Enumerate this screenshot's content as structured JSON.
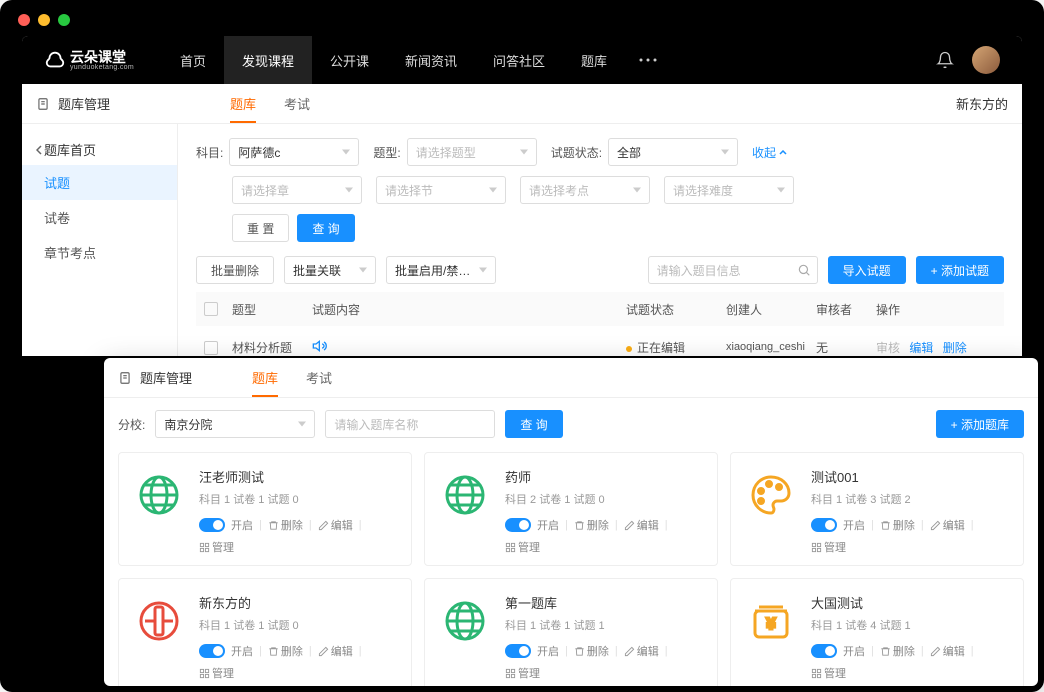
{
  "logo": {
    "name": "云朵课堂",
    "sub": "yunduoketang.com"
  },
  "nav": [
    "首页",
    "发现课程",
    "公开课",
    "新闻资讯",
    "问答社区",
    "题库"
  ],
  "nav_active": "发现课程",
  "win1": {
    "title": "题库管理",
    "tabs": [
      "题库",
      "考试"
    ],
    "org": "新东方的",
    "crumb": "题库首页",
    "sidebar": [
      "试题",
      "试卷",
      "章节考点"
    ],
    "filter_labels": {
      "subject": "科目:",
      "type": "题型:",
      "status": "试题状态:"
    },
    "subject_value": "阿萨德c",
    "type_placeholder": "请选择题型",
    "status_value": "全部",
    "chapter_placeholder": "请选择章",
    "section_placeholder": "请选择节",
    "point_placeholder": "请选择考点",
    "difficulty_placeholder": "请选择难度",
    "collapse_label": "收起",
    "reset_btn": "重 置",
    "search_btn": "查 询",
    "batch_delete": "批量删除",
    "batch_relate": "批量关联",
    "batch_toggle": "批量启用/禁…",
    "search_placeholder": "请输入题目信息",
    "import_btn": "导入试题",
    "add_btn": "+ 添加试题",
    "cols": {
      "type": "题型",
      "content": "试题内容",
      "status": "试题状态",
      "creator": "创建人",
      "reviewer": "审核者",
      "ops": "操作"
    },
    "row": {
      "type": "材料分析题",
      "status": "正在编辑",
      "creator": "xiaoqiang_ceshi",
      "reviewer": "无",
      "ops_review": "审核",
      "ops_edit": "编辑",
      "ops_del": "删除"
    }
  },
  "win2": {
    "title": "题库管理",
    "tabs": [
      "题库",
      "考试"
    ],
    "school_label": "分校:",
    "school_value": "南京分院",
    "name_placeholder": "请输入题库名称",
    "search_btn": "查 询",
    "add_btn": "+ 添加题库",
    "cards": [
      {
        "title": "汪老师测试",
        "meta": "科目 1  试卷 1  试题 0",
        "icon": "globe-green"
      },
      {
        "title": "药师",
        "meta": "科目 2  试卷 1  试题 0",
        "icon": "globe-green"
      },
      {
        "title": "测试001",
        "meta": "科目 1  试卷 3  试题 2",
        "icon": "palette-orange"
      },
      {
        "title": "新东方的",
        "meta": "科目 1  试卷 1  试题 0",
        "icon": "bank-red"
      },
      {
        "title": "第一题库",
        "meta": "科目 1  试卷 1  试题 1",
        "icon": "globe-green"
      },
      {
        "title": "大国测试",
        "meta": "科目 1  试卷 4  试题 1",
        "icon": "money-orange"
      }
    ],
    "ops": {
      "on": "开启",
      "del": "删除",
      "edit": "编辑",
      "manage": "管理"
    }
  }
}
